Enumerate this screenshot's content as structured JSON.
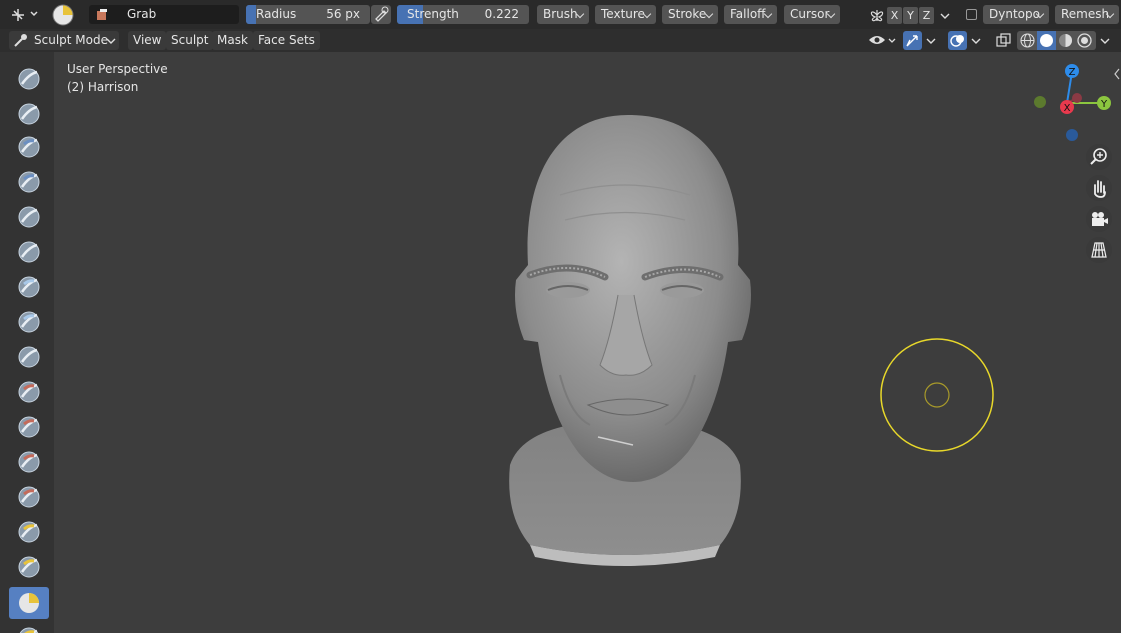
{
  "topbar": {
    "brush_name": "Grab",
    "radius": {
      "label": "Radius",
      "value": "56 px",
      "fraction": 0.04
    },
    "strength": {
      "label": "Strength",
      "value": "0.222",
      "fraction": 0.2
    },
    "menus": [
      "Brush",
      "Texture",
      "Stroke",
      "Falloff",
      "Cursor"
    ],
    "axes": [
      "X",
      "Y",
      "Z"
    ],
    "dyntopo_label": "Dyntopo",
    "remesh_label": "Remesh"
  },
  "header": {
    "mode_label": "Sculpt Mode",
    "menus": [
      "View",
      "Sculpt",
      "Mask",
      "Face Sets"
    ]
  },
  "viewport": {
    "perspective_label": "User Perspective",
    "object_label": "(2) Harrison"
  },
  "gizmo": {
    "x_label": "X",
    "y_label": "Y",
    "z_label": "Z"
  },
  "colors": {
    "accent": "#4772b3",
    "active_tool": "#5680c2",
    "brush_circle": "#e8d82a",
    "axis_x": "#e8394d",
    "axis_y": "#8cc63f",
    "axis_z": "#2d8ceb"
  }
}
